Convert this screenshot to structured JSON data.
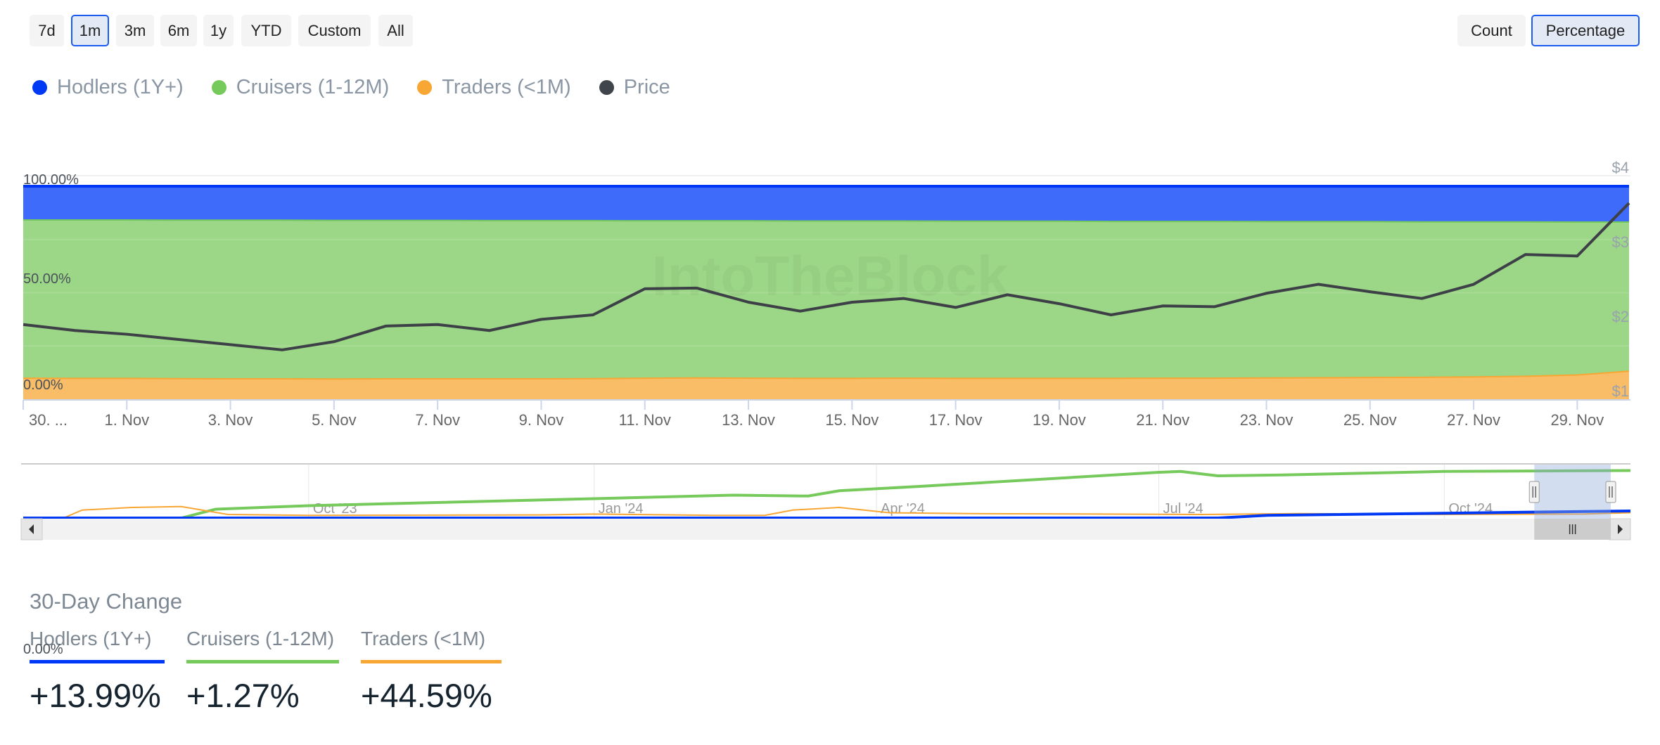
{
  "range_buttons": [
    {
      "label": "7d",
      "active": false
    },
    {
      "label": "1m",
      "active": true
    },
    {
      "label": "3m",
      "active": false
    },
    {
      "label": "6m",
      "active": false
    },
    {
      "label": "1y",
      "active": false
    },
    {
      "label": "YTD",
      "active": false
    },
    {
      "label": "Custom",
      "active": false
    },
    {
      "label": "All",
      "active": false
    }
  ],
  "mode_buttons": [
    {
      "label": "Count",
      "active": false
    },
    {
      "label": "Percentage",
      "active": true
    }
  ],
  "legend": [
    {
      "label": "Hodlers (1Y+)",
      "color": "#0039f5"
    },
    {
      "label": "Cruisers (1-12M)",
      "color": "#76c95b"
    },
    {
      "label": "Traders (<1M)",
      "color": "#f8a634"
    },
    {
      "label": "Price",
      "color": "#40454b"
    }
  ],
  "watermark": "IntoTheBlock",
  "chart_data": {
    "type": "area",
    "stacking": "percent",
    "x_tick_labels": [
      "30. ...",
      "1. Nov",
      "3. Nov",
      "5. Nov",
      "7. Nov",
      "9. Nov",
      "11. Nov",
      "13. Nov",
      "15. Nov",
      "17. Nov",
      "19. Nov",
      "21. Nov",
      "23. Nov",
      "25. Nov",
      "27. Nov",
      "29. Nov"
    ],
    "x": [
      "2024-10-30",
      "2024-10-31",
      "2024-11-01",
      "2024-11-02",
      "2024-11-03",
      "2024-11-04",
      "2024-11-05",
      "2024-11-06",
      "2024-11-07",
      "2024-11-08",
      "2024-11-09",
      "2024-11-10",
      "2024-11-11",
      "2024-11-12",
      "2024-11-13",
      "2024-11-14",
      "2024-11-15",
      "2024-11-16",
      "2024-11-17",
      "2024-11-18",
      "2024-11-19",
      "2024-11-20",
      "2024-11-21",
      "2024-11-22",
      "2024-11-23",
      "2024-11-24",
      "2024-11-25",
      "2024-11-26",
      "2024-11-27",
      "2024-11-28",
      "2024-11-29",
      "2024-11-30"
    ],
    "y_left": {
      "tick_labels": [
        "0.00%",
        "50.00%",
        "100.00%"
      ],
      "range": [
        0,
        100
      ]
    },
    "y_right": {
      "tick_labels": [
        "$1",
        "$2",
        "$3",
        "$4"
      ],
      "range": [
        1,
        4
      ]
    },
    "grid": true,
    "legend_placement": "top-left",
    "series": [
      {
        "name": "Hodlers (1Y+)",
        "color": "#3f6bfa",
        "line_color": "#0039f5",
        "values": [
          15.5,
          15.5,
          15.5,
          15.6,
          15.6,
          15.6,
          15.7,
          15.7,
          15.7,
          15.8,
          15.8,
          15.8,
          15.9,
          15.9,
          15.9,
          16.0,
          16.0,
          16.0,
          16.1,
          16.1,
          16.1,
          16.2,
          16.2,
          16.2,
          16.3,
          16.3,
          16.3,
          16.4,
          16.4,
          16.4,
          16.5,
          16.5
        ]
      },
      {
        "name": "Cruisers (1-12M)",
        "color": "#9cd687",
        "line_color": "#76c95b",
        "values": [
          74.3,
          74.4,
          74.4,
          74.4,
          74.5,
          74.5,
          74.5,
          74.4,
          74.4,
          74.3,
          74.3,
          74.2,
          73.9,
          73.8,
          73.9,
          73.9,
          73.9,
          73.8,
          73.8,
          73.8,
          73.8,
          73.7,
          73.6,
          73.6,
          73.4,
          73.3,
          73.2,
          73.0,
          72.8,
          72.5,
          71.8,
          70.0
        ]
      },
      {
        "name": "Traders (<1M)",
        "color": "#f8bd66",
        "line_color": "#f8a634",
        "values": [
          10.2,
          10.1,
          10.1,
          10.0,
          9.9,
          9.9,
          9.8,
          9.9,
          9.9,
          9.9,
          9.9,
          10.0,
          10.2,
          10.3,
          10.2,
          10.1,
          10.1,
          10.2,
          10.1,
          10.1,
          10.1,
          10.1,
          10.2,
          10.2,
          10.3,
          10.4,
          10.5,
          10.6,
          10.8,
          11.1,
          11.7,
          13.5
        ]
      }
    ],
    "price": {
      "name": "Price",
      "color": "#3d4046",
      "values": [
        1.87,
        1.79,
        1.74,
        1.67,
        1.6,
        1.53,
        1.64,
        1.85,
        1.87,
        1.79,
        1.94,
        2.0,
        2.35,
        2.36,
        2.17,
        2.05,
        2.17,
        2.22,
        2.1,
        2.27,
        2.15,
        2.0,
        2.12,
        2.11,
        2.29,
        2.41,
        2.31,
        2.22,
        2.41,
        2.81,
        2.79,
        3.5
      ]
    },
    "navigator": {
      "x_tick_labels": [
        "Oct '23",
        "Jan '24",
        "Apr '24",
        "Jul '24",
        "Oct '24"
      ],
      "x_tick_dates": [
        "2023-10-01",
        "2024-01-01",
        "2024-04-01",
        "2024-07-01",
        "2024-10-01"
      ],
      "range": [
        "2023-07-01",
        "2024-11-30"
      ],
      "selected": [
        "2024-10-30",
        "2024-11-30"
      ],
      "series": [
        {
          "name": "Cruisers (1-12M)",
          "color": "#76c95b",
          "points": [
            [
              "2023-08-21",
              0
            ],
            [
              "2023-09-01",
              10
            ],
            [
              "2023-10-01",
              14
            ],
            [
              "2024-01-01",
              22
            ],
            [
              "2024-02-15",
              26
            ],
            [
              "2024-03-10",
              25
            ],
            [
              "2024-03-20",
              31
            ],
            [
              "2024-04-15",
              36
            ],
            [
              "2024-07-01",
              52
            ],
            [
              "2024-07-08",
              53
            ],
            [
              "2024-07-20",
              48
            ],
            [
              "2024-08-10",
              49
            ],
            [
              "2024-10-01",
              53
            ],
            [
              "2024-11-30",
              54
            ]
          ]
        },
        {
          "name": "Traders (<1M)",
          "color": "#f8a634",
          "points": [
            [
              "2023-07-14",
              0
            ],
            [
              "2023-07-20",
              9
            ],
            [
              "2023-08-05",
              12
            ],
            [
              "2023-08-21",
              13
            ],
            [
              "2023-09-05",
              4
            ],
            [
              "2023-10-01",
              3
            ],
            [
              "2023-12-15",
              3.5
            ],
            [
              "2024-01-01",
              4.5
            ],
            [
              "2024-02-10",
              3
            ],
            [
              "2024-02-25",
              3
            ],
            [
              "2024-03-05",
              9
            ],
            [
              "2024-03-20",
              12
            ],
            [
              "2024-04-05",
              6
            ],
            [
              "2024-05-01",
              5
            ],
            [
              "2024-07-15",
              4
            ],
            [
              "2024-08-15",
              5
            ],
            [
              "2024-10-01",
              4
            ],
            [
              "2024-11-15",
              4.5
            ],
            [
              "2024-11-30",
              6
            ]
          ]
        },
        {
          "name": "Hodlers (1Y+)",
          "color": "#0039f5",
          "points": [
            [
              "2023-07-01",
              0
            ],
            [
              "2024-07-20",
              0
            ],
            [
              "2024-08-05",
              3
            ],
            [
              "2024-11-30",
              8
            ]
          ]
        }
      ]
    }
  },
  "summary": {
    "title": "30-Day Change",
    "stray_label": "0.00%",
    "items": [
      {
        "label": "Hodlers (1Y+)",
        "value": "+13.99%",
        "color": "#0039f5"
      },
      {
        "label": "Cruisers (1-12M)",
        "value": "+1.27%",
        "color": "#76c95b"
      },
      {
        "label": "Traders (<1M)",
        "value": "+44.59%",
        "color": "#f8a634"
      }
    ]
  }
}
